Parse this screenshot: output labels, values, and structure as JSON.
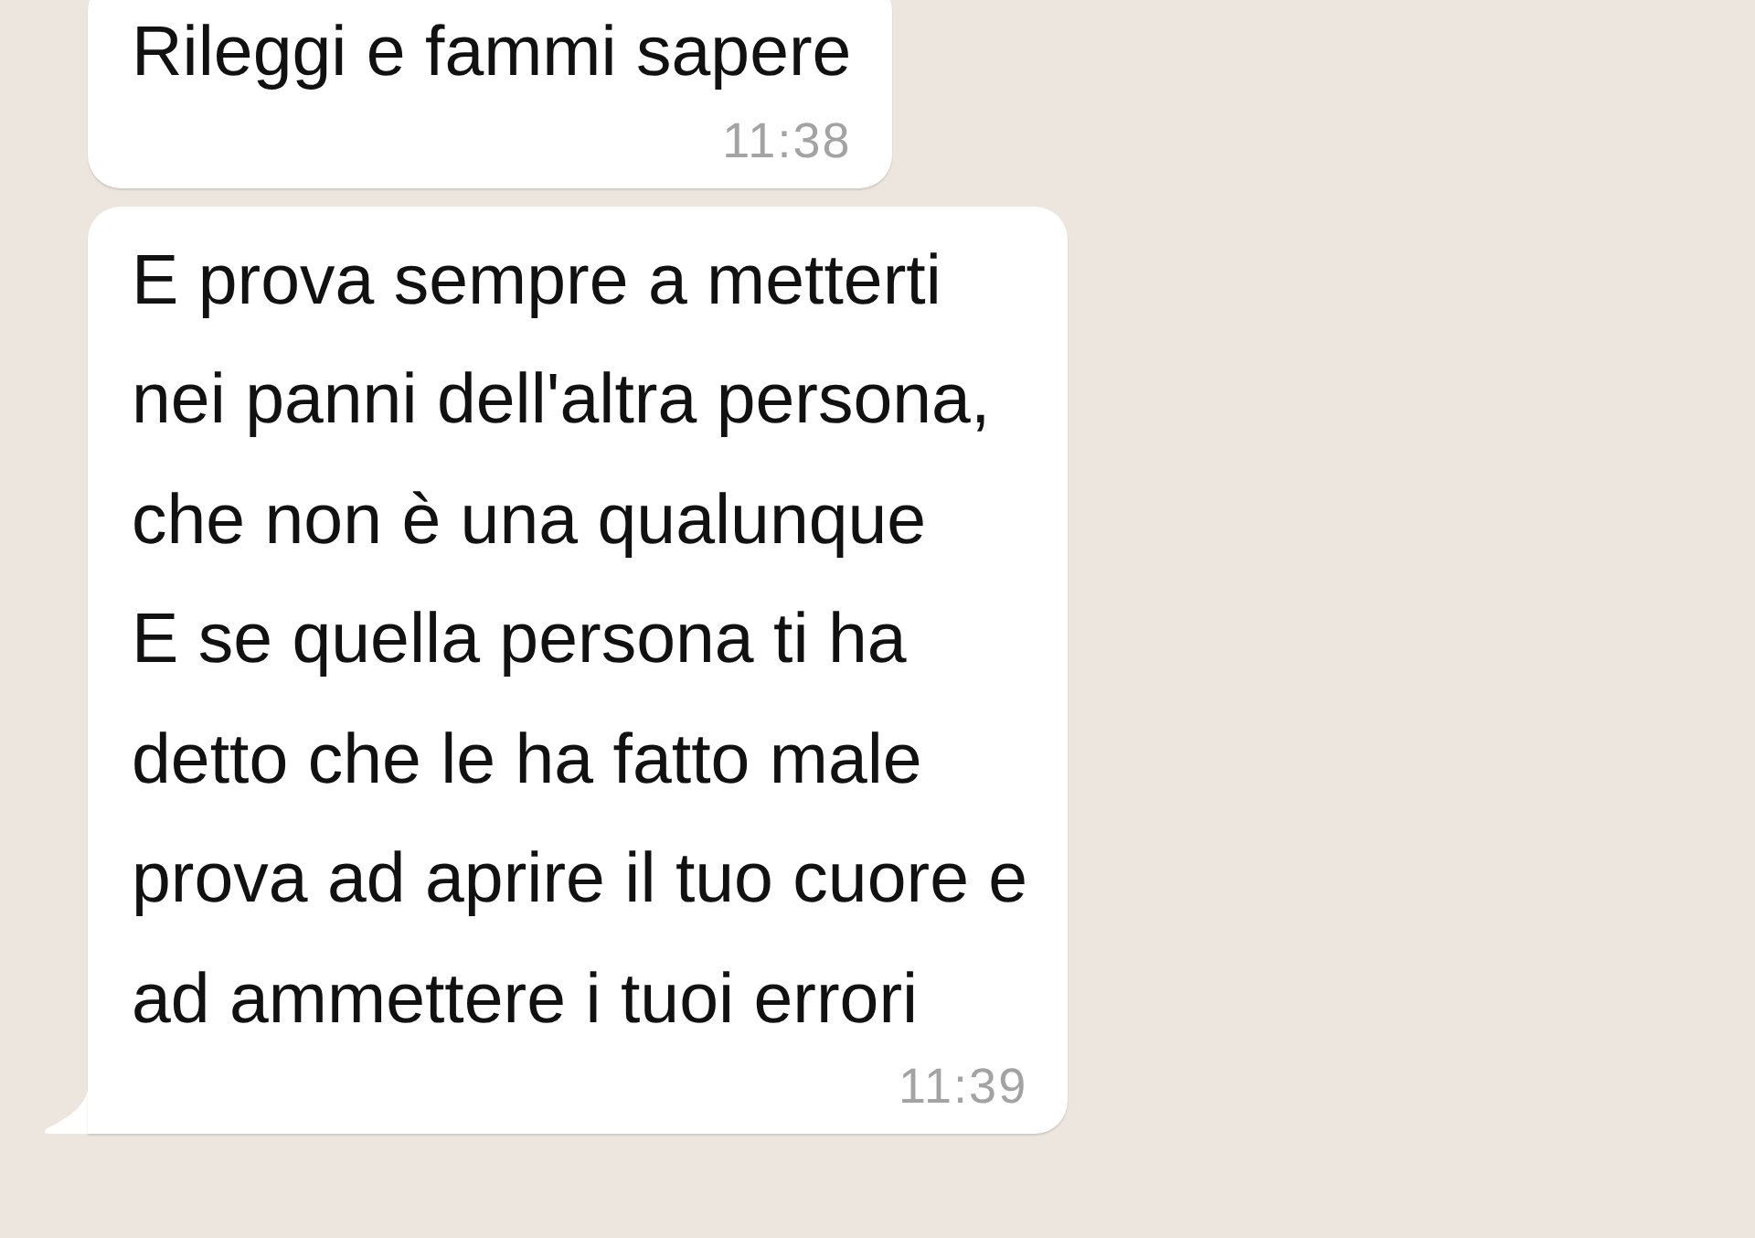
{
  "messages": [
    {
      "text": "Rileggi e fammi sapere",
      "time": "11:38",
      "tail": false
    },
    {
      "text": "E prova sempre a metterti\nnei panni dell'altra persona,\nche non è una qualunque\nE se quella persona ti ha\ndetto che le ha fatto male\nprova ad aprire il tuo cuore e\nad ammettere i tuoi errori",
      "time": "11:39",
      "tail": true
    }
  ]
}
